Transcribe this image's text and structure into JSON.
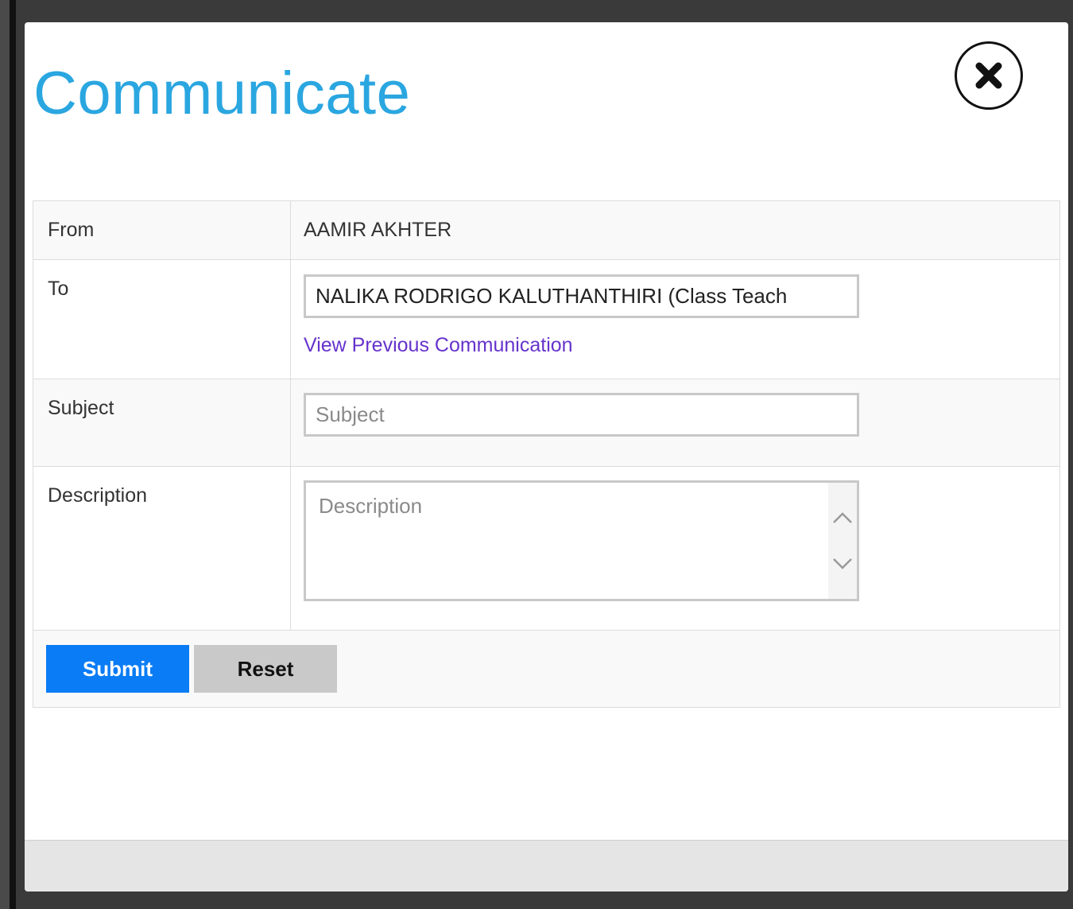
{
  "modal": {
    "title": "Communicate",
    "close_icon": "close-x-circle-icon"
  },
  "form": {
    "from_label": "From",
    "from_value": "AAMIR AKHTER",
    "to_label": "To",
    "to_value": "NALIKA RODRIGO KALUTHANTHIRI   (Class Teach",
    "previous_link": "View Previous Communication",
    "subject_label": "Subject",
    "subject_placeholder": "Subject",
    "description_label": "Description",
    "description_placeholder": "Description"
  },
  "buttons": {
    "submit": "Submit",
    "reset": "Reset"
  },
  "colors": {
    "title": "#2aa6e0",
    "submit_bg": "#0a7cf5",
    "reset_bg": "#c9c9c9",
    "link": "#6633cc"
  }
}
